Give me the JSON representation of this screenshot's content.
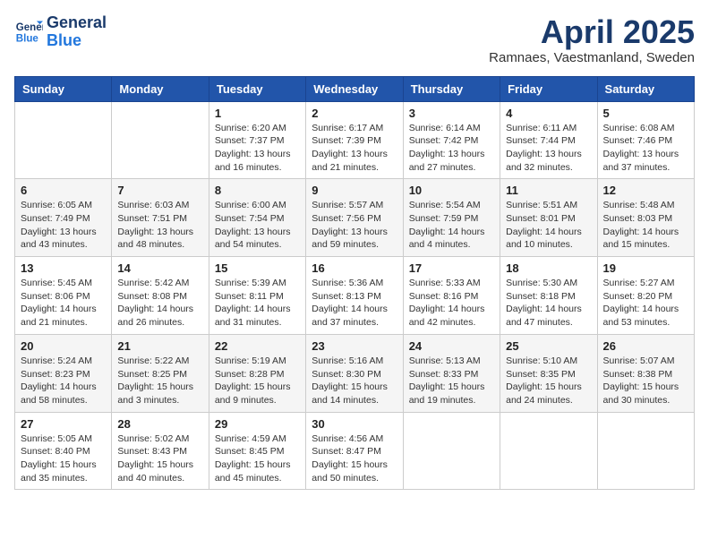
{
  "header": {
    "logo_line1": "General",
    "logo_line2": "Blue",
    "month_title": "April 2025",
    "subtitle": "Ramnaes, Vaestmanland, Sweden"
  },
  "weekdays": [
    "Sunday",
    "Monday",
    "Tuesday",
    "Wednesday",
    "Thursday",
    "Friday",
    "Saturday"
  ],
  "weeks": [
    [
      {
        "day": "",
        "info": ""
      },
      {
        "day": "",
        "info": ""
      },
      {
        "day": "1",
        "info": "Sunrise: 6:20 AM\nSunset: 7:37 PM\nDaylight: 13 hours and 16 minutes."
      },
      {
        "day": "2",
        "info": "Sunrise: 6:17 AM\nSunset: 7:39 PM\nDaylight: 13 hours and 21 minutes."
      },
      {
        "day": "3",
        "info": "Sunrise: 6:14 AM\nSunset: 7:42 PM\nDaylight: 13 hours and 27 minutes."
      },
      {
        "day": "4",
        "info": "Sunrise: 6:11 AM\nSunset: 7:44 PM\nDaylight: 13 hours and 32 minutes."
      },
      {
        "day": "5",
        "info": "Sunrise: 6:08 AM\nSunset: 7:46 PM\nDaylight: 13 hours and 37 minutes."
      }
    ],
    [
      {
        "day": "6",
        "info": "Sunrise: 6:05 AM\nSunset: 7:49 PM\nDaylight: 13 hours and 43 minutes."
      },
      {
        "day": "7",
        "info": "Sunrise: 6:03 AM\nSunset: 7:51 PM\nDaylight: 13 hours and 48 minutes."
      },
      {
        "day": "8",
        "info": "Sunrise: 6:00 AM\nSunset: 7:54 PM\nDaylight: 13 hours and 54 minutes."
      },
      {
        "day": "9",
        "info": "Sunrise: 5:57 AM\nSunset: 7:56 PM\nDaylight: 13 hours and 59 minutes."
      },
      {
        "day": "10",
        "info": "Sunrise: 5:54 AM\nSunset: 7:59 PM\nDaylight: 14 hours and 4 minutes."
      },
      {
        "day": "11",
        "info": "Sunrise: 5:51 AM\nSunset: 8:01 PM\nDaylight: 14 hours and 10 minutes."
      },
      {
        "day": "12",
        "info": "Sunrise: 5:48 AM\nSunset: 8:03 PM\nDaylight: 14 hours and 15 minutes."
      }
    ],
    [
      {
        "day": "13",
        "info": "Sunrise: 5:45 AM\nSunset: 8:06 PM\nDaylight: 14 hours and 21 minutes."
      },
      {
        "day": "14",
        "info": "Sunrise: 5:42 AM\nSunset: 8:08 PM\nDaylight: 14 hours and 26 minutes."
      },
      {
        "day": "15",
        "info": "Sunrise: 5:39 AM\nSunset: 8:11 PM\nDaylight: 14 hours and 31 minutes."
      },
      {
        "day": "16",
        "info": "Sunrise: 5:36 AM\nSunset: 8:13 PM\nDaylight: 14 hours and 37 minutes."
      },
      {
        "day": "17",
        "info": "Sunrise: 5:33 AM\nSunset: 8:16 PM\nDaylight: 14 hours and 42 minutes."
      },
      {
        "day": "18",
        "info": "Sunrise: 5:30 AM\nSunset: 8:18 PM\nDaylight: 14 hours and 47 minutes."
      },
      {
        "day": "19",
        "info": "Sunrise: 5:27 AM\nSunset: 8:20 PM\nDaylight: 14 hours and 53 minutes."
      }
    ],
    [
      {
        "day": "20",
        "info": "Sunrise: 5:24 AM\nSunset: 8:23 PM\nDaylight: 14 hours and 58 minutes."
      },
      {
        "day": "21",
        "info": "Sunrise: 5:22 AM\nSunset: 8:25 PM\nDaylight: 15 hours and 3 minutes."
      },
      {
        "day": "22",
        "info": "Sunrise: 5:19 AM\nSunset: 8:28 PM\nDaylight: 15 hours and 9 minutes."
      },
      {
        "day": "23",
        "info": "Sunrise: 5:16 AM\nSunset: 8:30 PM\nDaylight: 15 hours and 14 minutes."
      },
      {
        "day": "24",
        "info": "Sunrise: 5:13 AM\nSunset: 8:33 PM\nDaylight: 15 hours and 19 minutes."
      },
      {
        "day": "25",
        "info": "Sunrise: 5:10 AM\nSunset: 8:35 PM\nDaylight: 15 hours and 24 minutes."
      },
      {
        "day": "26",
        "info": "Sunrise: 5:07 AM\nSunset: 8:38 PM\nDaylight: 15 hours and 30 minutes."
      }
    ],
    [
      {
        "day": "27",
        "info": "Sunrise: 5:05 AM\nSunset: 8:40 PM\nDaylight: 15 hours and 35 minutes."
      },
      {
        "day": "28",
        "info": "Sunrise: 5:02 AM\nSunset: 8:43 PM\nDaylight: 15 hours and 40 minutes."
      },
      {
        "day": "29",
        "info": "Sunrise: 4:59 AM\nSunset: 8:45 PM\nDaylight: 15 hours and 45 minutes."
      },
      {
        "day": "30",
        "info": "Sunrise: 4:56 AM\nSunset: 8:47 PM\nDaylight: 15 hours and 50 minutes."
      },
      {
        "day": "",
        "info": ""
      },
      {
        "day": "",
        "info": ""
      },
      {
        "day": "",
        "info": ""
      }
    ]
  ]
}
